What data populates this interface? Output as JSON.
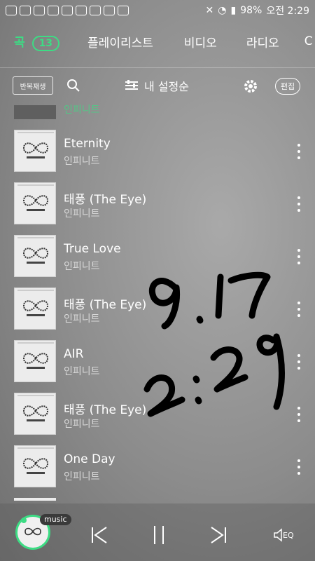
{
  "status_bar": {
    "battery": "98%",
    "time": "오전 2:29"
  },
  "tabs": [
    {
      "label": "곡",
      "count": "13",
      "active": true
    },
    {
      "label": "플레이리스트",
      "active": false
    },
    {
      "label": "비디오",
      "active": false
    },
    {
      "label": "라디오",
      "active": false
    },
    {
      "label": "C",
      "active": false
    }
  ],
  "toolbar": {
    "repeat_label": "반복재생",
    "sort_label": "내 설정순",
    "edit_label": "편집"
  },
  "partial_top_artist": "인피니트",
  "songs": [
    {
      "title": "Eternity",
      "artist": "인피니트"
    },
    {
      "title": "태풍 (The Eye)",
      "artist": "인피니트"
    },
    {
      "title": "True Love",
      "artist": "인피니트"
    },
    {
      "title": "태풍 (The Eye)",
      "artist": "인피니트"
    },
    {
      "title": "AIR",
      "artist": "인피니트"
    },
    {
      "title": "태풍 (The Eye)",
      "artist": "인피니트"
    },
    {
      "title": "One Day",
      "artist": "인피니트"
    }
  ],
  "player": {
    "music_tag": "music",
    "eq_label": "EQ"
  },
  "handwriting_text": "9.17 2:29",
  "colors": {
    "accent": "#3ddc84"
  }
}
